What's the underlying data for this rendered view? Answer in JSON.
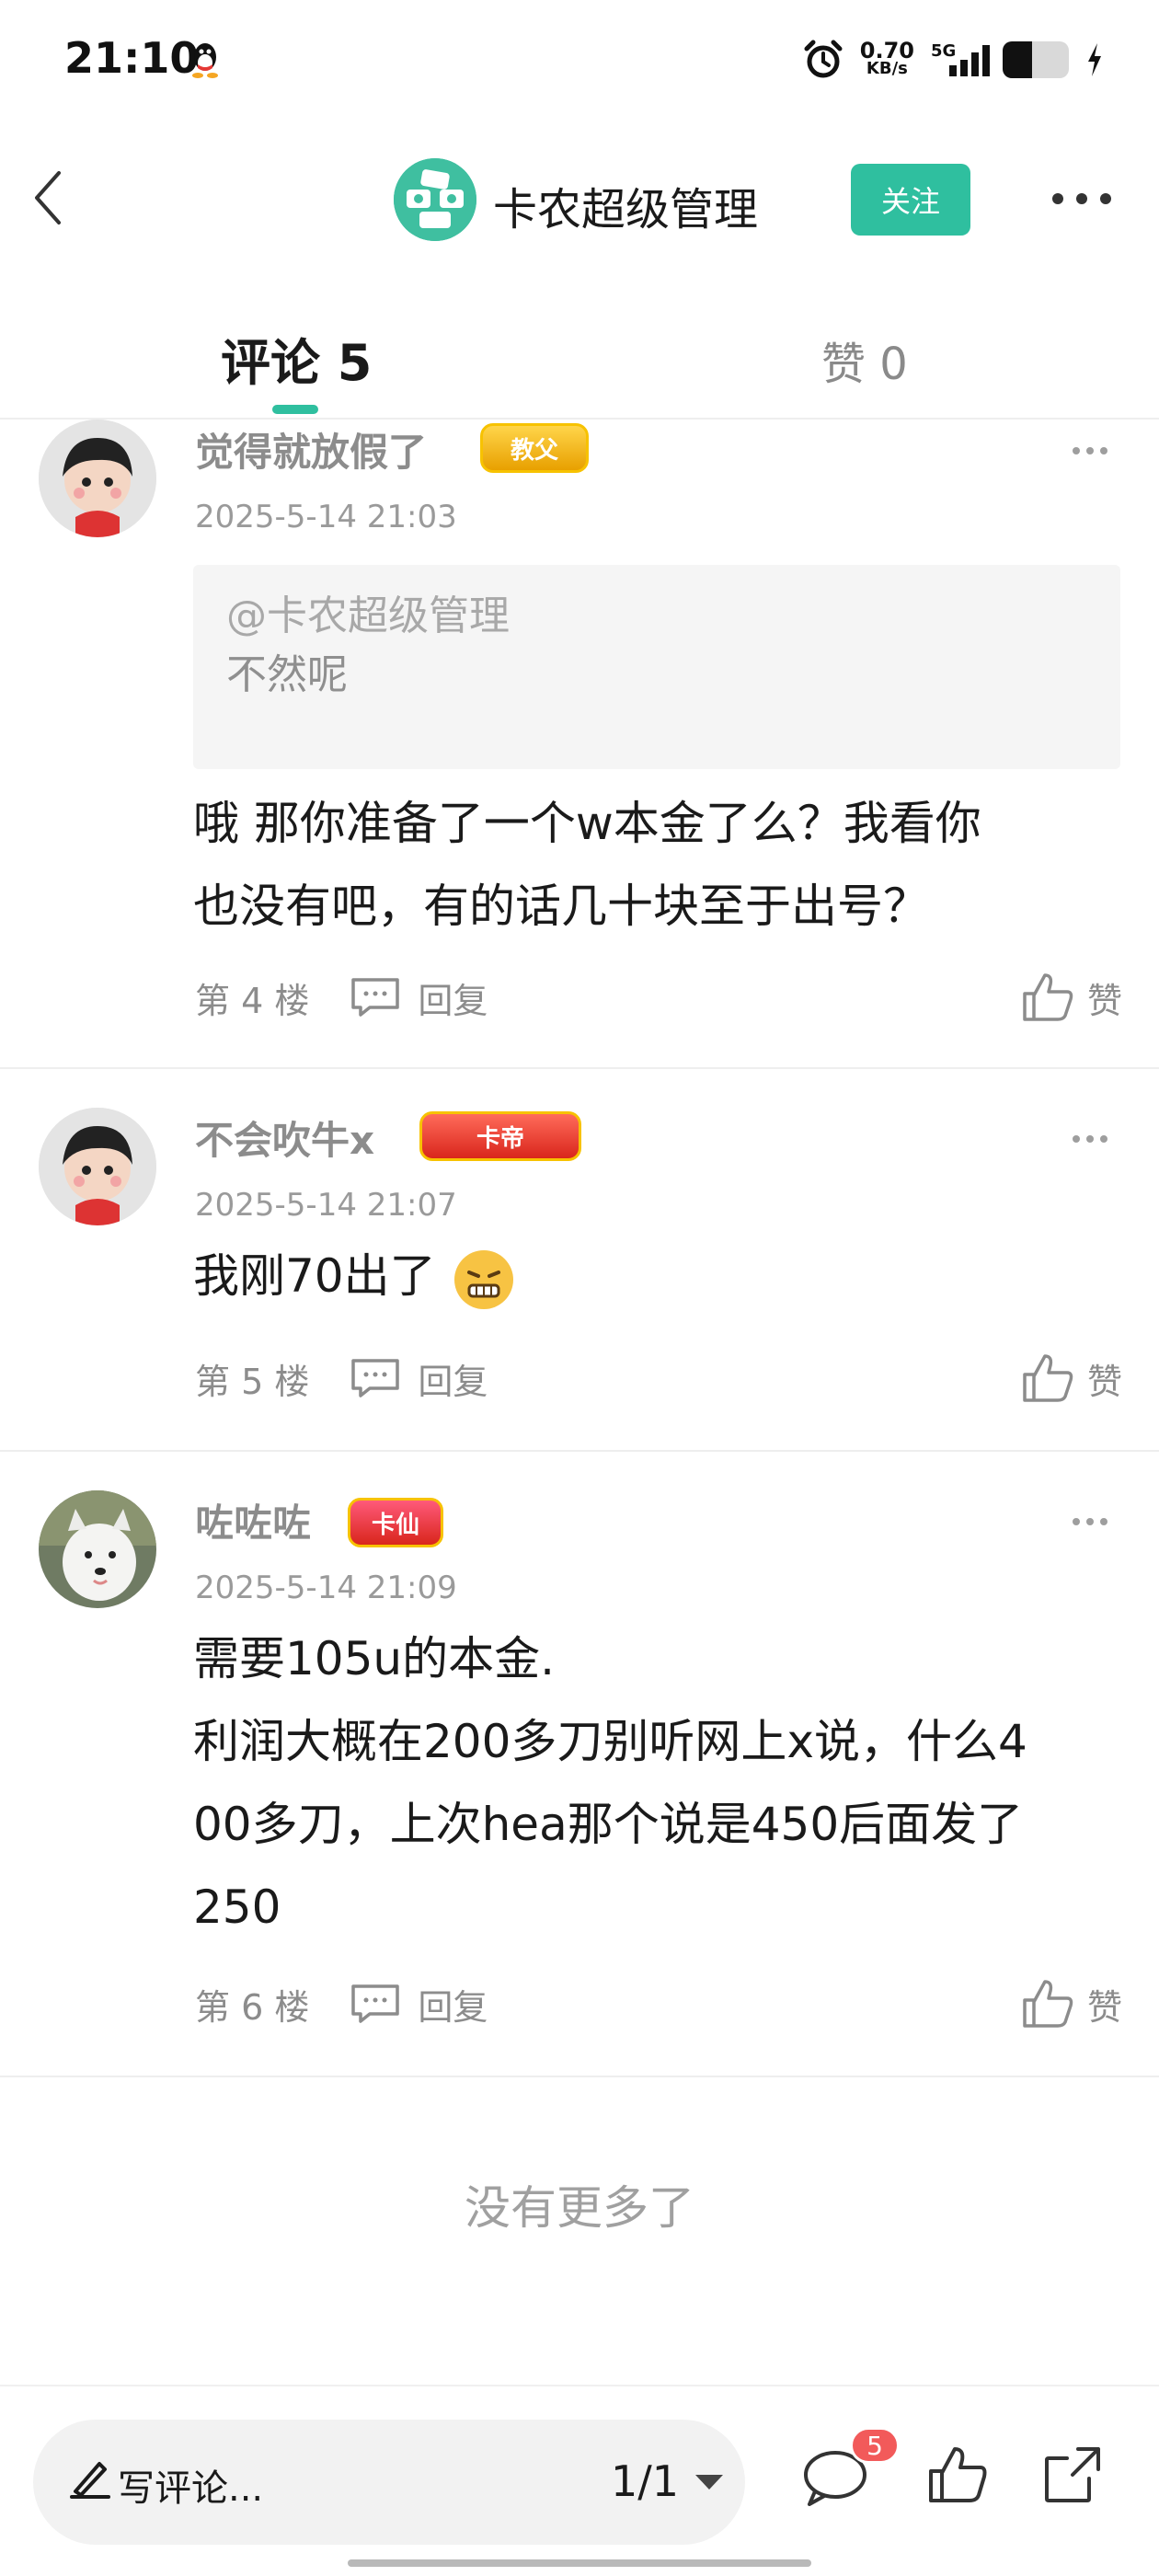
{
  "status_bar": {
    "time": "21:10",
    "net_speed_value": "0.70",
    "net_speed_unit": "KB/s",
    "network_type": "5G",
    "battery_level": 0.45,
    "icons": [
      "qq-icon",
      "alarm-icon",
      "signal-icon",
      "battery-icon",
      "charging-icon"
    ]
  },
  "header": {
    "club_name": "卡农超级管理",
    "follow_label": "关注",
    "logo_color": "#3fbfa0"
  },
  "tabs": {
    "comments_label": "评论 5",
    "likes_label": "赞 0"
  },
  "comments": [
    {
      "user": "觉得就放假了",
      "badge": "教父",
      "time": "2025-5-14 21:03",
      "quote_user": "@卡农超级管理",
      "quote_text": "不然呢",
      "text_line1": "哦 那你准备了一个w本金了么？我看你",
      "text_line2": "也没有吧，有的话几十块至于出号？",
      "floor": "第 4 楼",
      "reply_label": "回复",
      "like_label": "赞"
    },
    {
      "user": "不会吹牛x",
      "badge": "卡帝",
      "time": "2025-5-14 21:07",
      "text_line1": "我刚70出了",
      "floor": "第 5 楼",
      "reply_label": "回复",
      "like_label": "赞"
    },
    {
      "user": "咗咗咗",
      "badge": "卡仙",
      "time": "2025-5-14 21:09",
      "text_line1": "需要105u的本金.",
      "text_line2": "利润大概在200多刀别听网上x说，什么4",
      "text_line3": "00多刀，上次hea那个说是450后面发了",
      "text_line4": "250",
      "floor": "第 6 楼",
      "reply_label": "回复",
      "like_label": "赞"
    }
  ],
  "no_more_label": "没有更多了",
  "bottom_bar": {
    "input_label": "写评论...",
    "page_indicator": "1/1",
    "comment_count": "5"
  },
  "colors": {
    "accent": "#2fbf9f",
    "badge_red": "#f25a5a",
    "muted_text": "#8c8c8c"
  }
}
